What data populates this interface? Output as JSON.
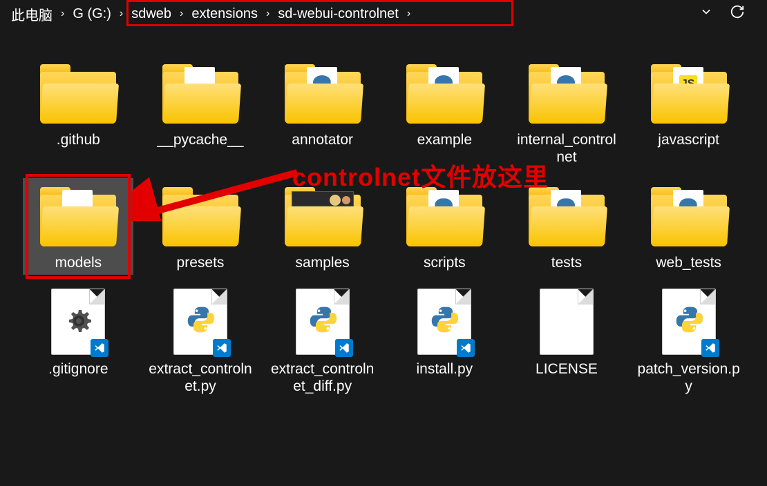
{
  "breadcrumb": {
    "items": [
      "此电脑",
      "G (G:)",
      "sdweb",
      "extensions",
      "sd-webui-controlnet"
    ],
    "separator": "›"
  },
  "toolbar": {},
  "items": [
    {
      "name": ".github",
      "type": "folder-empty"
    },
    {
      "name": "__pycache__",
      "type": "folder-paper"
    },
    {
      "name": "annotator",
      "type": "folder-py"
    },
    {
      "name": "example",
      "type": "folder-py"
    },
    {
      "name": "internal_controlnet",
      "type": "folder-py"
    },
    {
      "name": "javascript",
      "type": "folder-js"
    },
    {
      "name": "models",
      "type": "folder-paper",
      "selected": true,
      "redbox": true
    },
    {
      "name": "presets",
      "type": "folder-empty"
    },
    {
      "name": "samples",
      "type": "folder-image"
    },
    {
      "name": "scripts",
      "type": "folder-py"
    },
    {
      "name": "tests",
      "type": "folder-py"
    },
    {
      "name": "web_tests",
      "type": "folder-py"
    },
    {
      "name": ".gitignore",
      "type": "file-gear"
    },
    {
      "name": "extract_controlnet.py",
      "type": "file-py"
    },
    {
      "name": "extract_controlnet_diff.py",
      "type": "file-py"
    },
    {
      "name": "install.py",
      "type": "file-py"
    },
    {
      "name": "LICENSE",
      "type": "file-plain"
    },
    {
      "name": "patch_version.py",
      "type": "file-py"
    }
  ],
  "annotation": {
    "text": "controlnet文件放这里"
  }
}
